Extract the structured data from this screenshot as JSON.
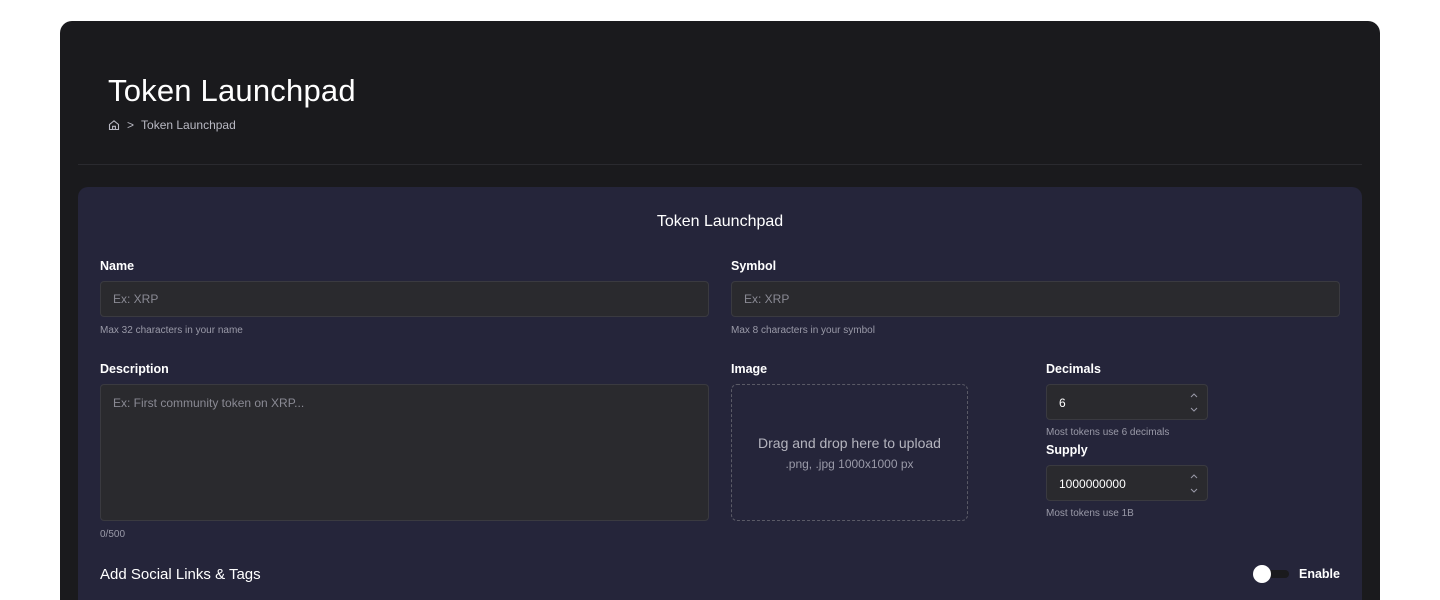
{
  "header": {
    "title": "Token Launchpad",
    "breadcrumb": {
      "home_icon": "home-icon",
      "separator": ">",
      "current": "Token Launchpad"
    }
  },
  "form": {
    "title": "Token Launchpad",
    "name": {
      "label": "Name",
      "placeholder": "Ex: XRP",
      "value": "",
      "hint": "Max 32 characters in your name"
    },
    "symbol": {
      "label": "Symbol",
      "placeholder": "Ex: XRP",
      "value": "",
      "hint": "Max 8 characters in your symbol"
    },
    "description": {
      "label": "Description",
      "placeholder": "Ex: First community token on XRP...",
      "value": "",
      "counter": "0/500"
    },
    "image": {
      "label": "Image",
      "drop_text": "Drag and drop here to upload",
      "formats": ".png, .jpg 1000x1000 px"
    },
    "decimals": {
      "label": "Decimals",
      "value": "6",
      "hint": "Most tokens use 6 decimals"
    },
    "supply": {
      "label": "Supply",
      "value": "1000000000",
      "hint": "Most tokens use 1B"
    },
    "social": {
      "title": "Add Social Links & Tags",
      "toggle_label": "Enable",
      "enabled": false
    }
  },
  "colors": {
    "page": "#ffffff",
    "shell": "#1a1a1d",
    "card": "#25253a",
    "input": "#2a2a2e"
  }
}
